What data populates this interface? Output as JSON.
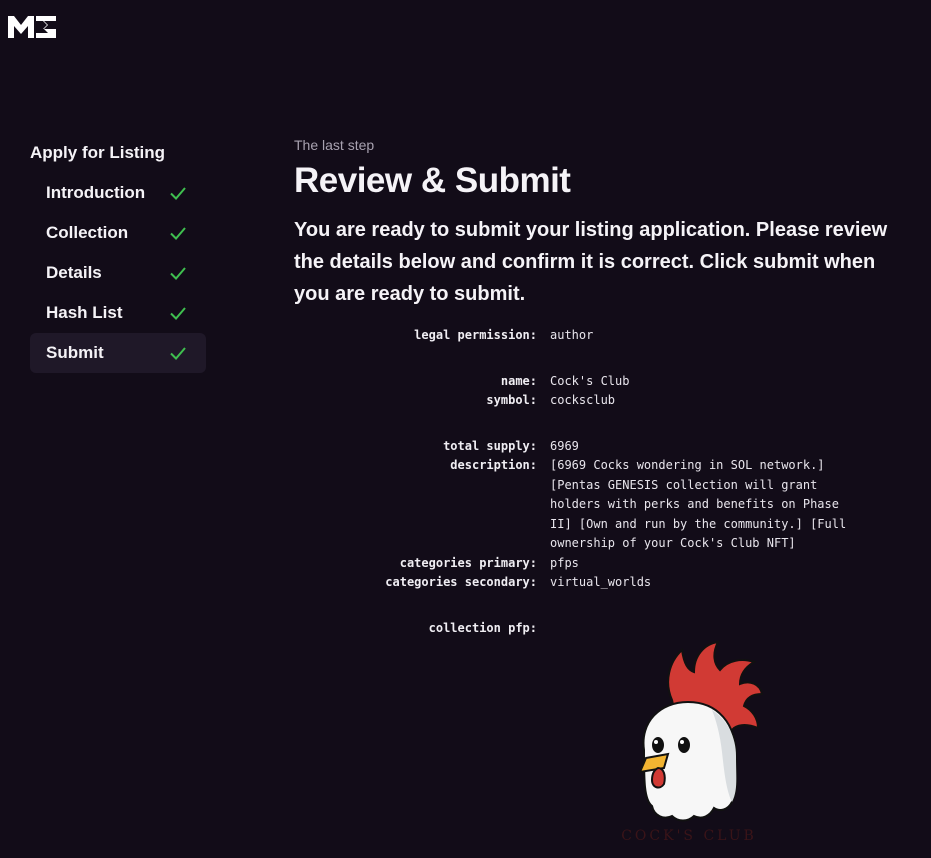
{
  "brand": {
    "logo_icon": "magic-eden-logo-icon"
  },
  "sidebar": {
    "title": "Apply for Listing",
    "steps": [
      {
        "label": "Introduction",
        "done": true
      },
      {
        "label": "Collection",
        "done": true
      },
      {
        "label": "Details",
        "done": true
      },
      {
        "label": "Hash List",
        "done": true
      },
      {
        "label": "Submit",
        "done": true,
        "active": true
      }
    ]
  },
  "main": {
    "eyebrow": "The last step",
    "heading": "Review & Submit",
    "intro": "You are ready to submit your listing application. Please review the details below and confirm it is correct. Click submit when you are ready to submit."
  },
  "details": {
    "legal_permission": {
      "key": "legal permission:",
      "value": "author"
    },
    "name": {
      "key": "name:",
      "value": "Cock's Club"
    },
    "symbol": {
      "key": "symbol:",
      "value": "cocksclub"
    },
    "total_supply": {
      "key": "total supply:",
      "value": "6969"
    },
    "description": {
      "key": "description:",
      "value": "[6969 Cocks wondering in SOL network.] [Pentas GENESIS collection will grant holders with perks and benefits on Phase II] [Own and run by the community.] [Full ownership of your Cock's Club NFT]"
    },
    "categories_primary": {
      "key": "categories primary:",
      "value": "pfps"
    },
    "categories_secondary": {
      "key": "categories secondary:",
      "value": "virtual_worlds"
    },
    "collection_pfp": {
      "key": "collection pfp:",
      "image_text": "COCK'S CLUB"
    }
  },
  "colors": {
    "background": "#120c18",
    "check": "#3fbf4f",
    "active_step": "#1f1828",
    "muted": "#a8a2b0"
  }
}
